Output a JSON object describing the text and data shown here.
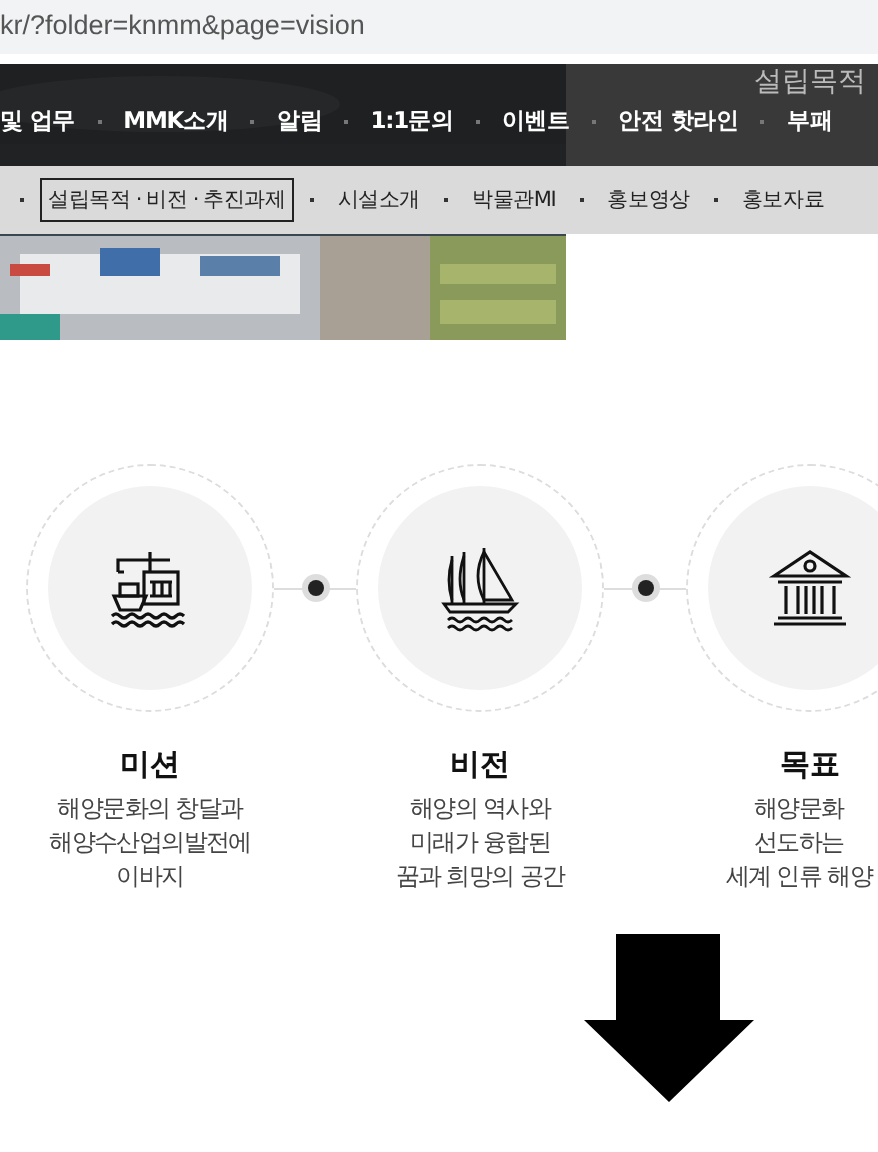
{
  "address_bar": {
    "url": "kr/?folder=knmm&page=vision"
  },
  "hero": {
    "side_title": "설립목적"
  },
  "main_nav": {
    "items": [
      "및 업무",
      "MMK소개",
      "알림",
      "1:1문의",
      "이벤트",
      "안전 핫라인",
      "부패"
    ]
  },
  "sub_nav": {
    "items": [
      {
        "label": "설립목적 · 비전 · 추진과제",
        "selected": true
      },
      {
        "label": "시설소개",
        "selected": false
      },
      {
        "label": "박물관MI",
        "selected": false
      },
      {
        "label": "홍보영상",
        "selected": false
      },
      {
        "label": "홍보자료",
        "selected": false
      }
    ]
  },
  "values": [
    {
      "title": "미션",
      "lines": [
        "해양문화의 창달과",
        "해양수산업의발전에",
        "이바지"
      ]
    },
    {
      "title": "비전",
      "lines": [
        "해양의 역사와",
        "미래가 융합된",
        "꿈과 희망의 공간"
      ]
    },
    {
      "title": "목표",
      "lines": [
        "해양문화",
        "선도하는",
        "세계 인류 해양"
      ]
    }
  ]
}
